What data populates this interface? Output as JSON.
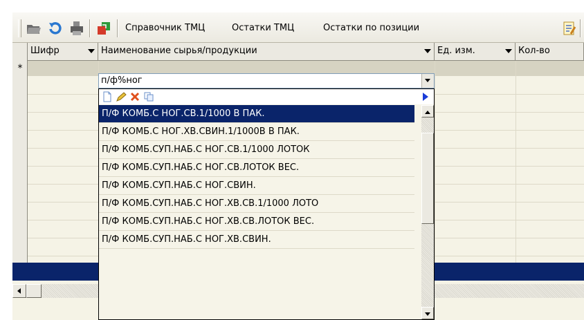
{
  "toolbar": {
    "buttons": [
      {
        "label": "Справочник ТМЦ"
      },
      {
        "label": "Остатки ТМЦ"
      },
      {
        "label": "Остатки по позиции"
      }
    ]
  },
  "grid": {
    "columns": [
      {
        "label": "Шифр"
      },
      {
        "label": "Наименование сырья/продукции"
      },
      {
        "label": "Ед. изм."
      },
      {
        "label": "Кол-во"
      }
    ],
    "new_row_marker": "*"
  },
  "combo": {
    "value": "п/ф%ног"
  },
  "dropdown": {
    "items": [
      {
        "label": "П/Ф КОМБ.С НОГ.СВ.1/1000 В ПАК.",
        "selected": true
      },
      {
        "label": "П/Ф КОМБ.С НОГ.ХВ.СВИН.1/1000В В ПАК."
      },
      {
        "label": "П/Ф КОМБ.СУП.НАБ.С НОГ.СВ.1/1000 ЛОТОК"
      },
      {
        "label": "П/Ф КОМБ.СУП.НАБ.С НОГ.СВ.ЛОТОК ВЕС."
      },
      {
        "label": "П/Ф КОМБ.СУП.НАБ.С НОГ.СВИН."
      },
      {
        "label": "П/Ф КОМБ.СУП.НАБ.С НОГ.ХВ.СВ.1/1000 ЛОТО"
      },
      {
        "label": "П/Ф КОМБ.СУП.НАБ.С НОГ.ХВ.СВ.ЛОТОК ВЕС."
      },
      {
        "label": "П/Ф КОМБ.СУП.НАБ.С НОГ.ХВ.СВИН."
      }
    ]
  },
  "colors": {
    "selection": "#0a246a",
    "grid_bg": "#f5f3e6",
    "toolbar_bg": "#ebe9e0"
  },
  "icons": [
    "open-folder-icon",
    "refresh-icon",
    "print-icon",
    "export-icon",
    "edit-document-icon",
    "new-icon",
    "edit-icon",
    "delete-icon",
    "copy-icon",
    "play-right-icon"
  ]
}
